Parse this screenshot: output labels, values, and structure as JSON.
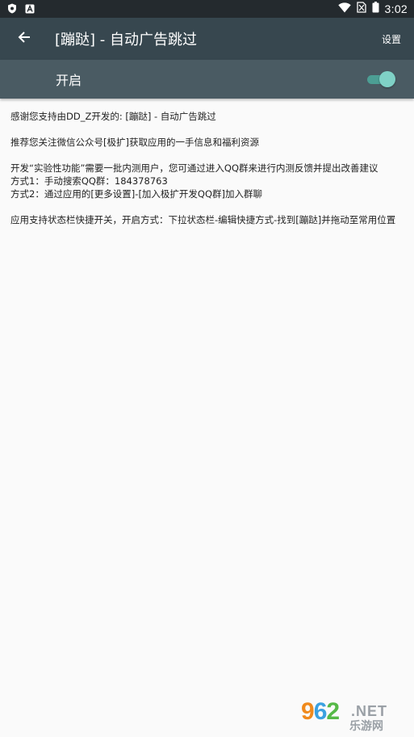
{
  "status_bar": {
    "time": "3:02",
    "icons_left": [
      "shield-icon",
      "app-a-icon"
    ],
    "icons_right": [
      "wifi-icon",
      "no-sim-icon",
      "battery-icon"
    ]
  },
  "app_bar": {
    "title": "[蹦跶] - 自动广告跳过",
    "settings_label": "设置",
    "color": "#37474f"
  },
  "toggle_row": {
    "label": "开启",
    "enabled": true,
    "color": "#4a5b63",
    "accent": "#7fd1c6"
  },
  "content": {
    "thanks": "感谢您支持由DD_Z开发的: [蹦跶] - 自动广告跳过",
    "recommend": "推荐您关注微信公众号[极扩]获取应用的一手信息和福利资源",
    "beta_intro": "开发“实验性功能”需要一批内测用户，您可通过进入QQ群来进行内测反馈并提出改善建议",
    "method1": "方式1：手动搜索QQ群：184378763",
    "method2": "方式2：通过应用的[更多设置]-[加入极扩开发QQ群]加入群聊",
    "tile_tip": "应用支持状态栏快捷开关，开启方式：下拉状态栏-编辑快捷方式-找到[蹦跶]并拖动至常用位置"
  },
  "watermark": {
    "digit1": "9",
    "digit2": "6",
    "digit3": "2",
    "suffix": ".NET",
    "cn": "乐游网"
  }
}
